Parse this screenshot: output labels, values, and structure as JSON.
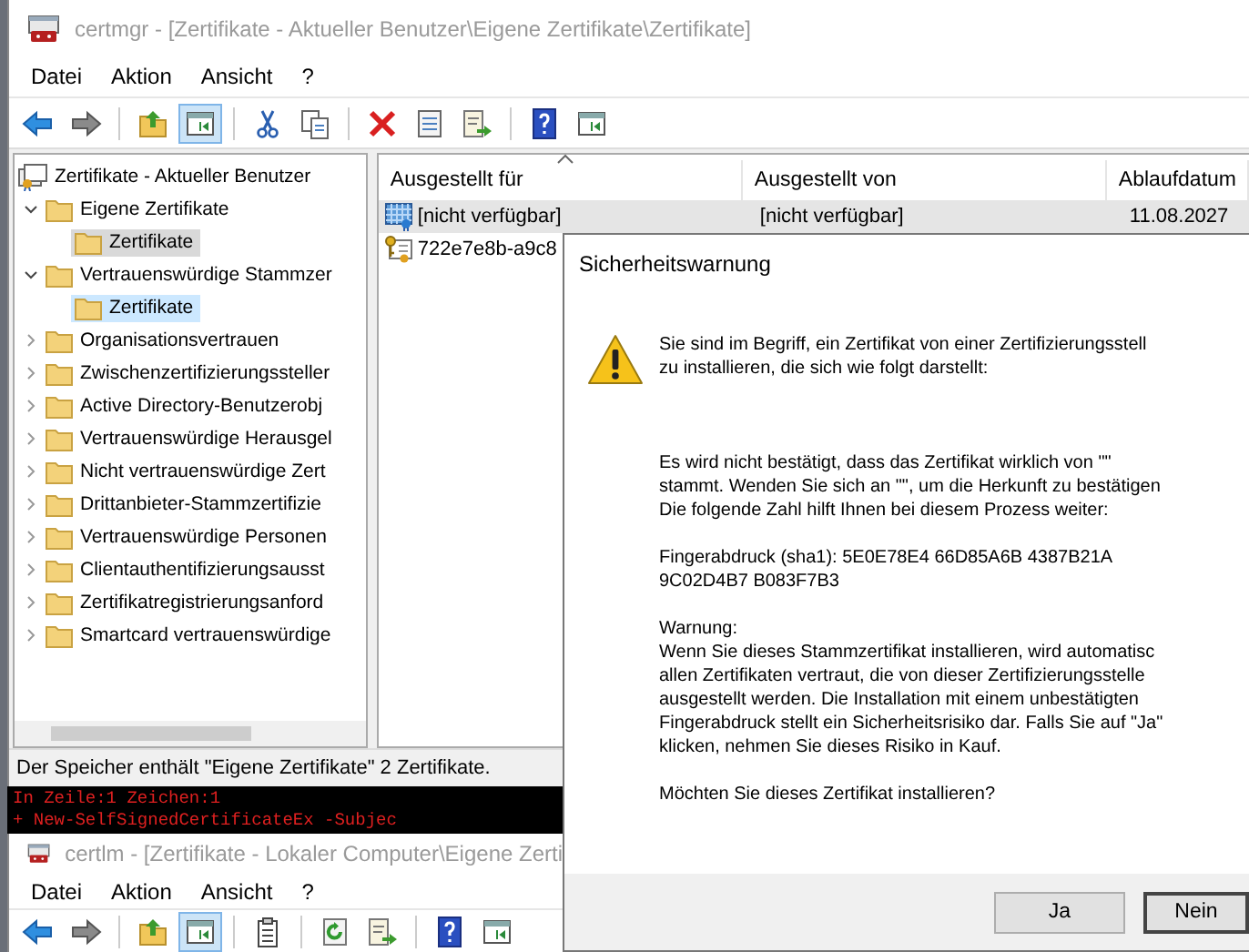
{
  "main_window": {
    "title": "certmgr - [Zertifikate - Aktueller Benutzer\\Eigene Zertifikate\\Zertifikate]",
    "menu": [
      "Datei",
      "Aktion",
      "Ansicht",
      "?"
    ],
    "toolbar": [
      {
        "buttons": [
          {
            "kind": "back",
            "pressed": false
          },
          {
            "kind": "forward",
            "pressed": false
          }
        ]
      },
      {
        "buttons": [
          {
            "kind": "folder-up",
            "pressed": false
          },
          {
            "kind": "pane",
            "pressed": true
          }
        ]
      },
      {
        "buttons": [
          {
            "kind": "cut",
            "pressed": false
          },
          {
            "kind": "copy",
            "pressed": false
          }
        ]
      },
      {
        "buttons": [
          {
            "kind": "delete",
            "pressed": false
          },
          {
            "kind": "properties",
            "pressed": false
          },
          {
            "kind": "export",
            "pressed": false
          }
        ]
      },
      {
        "buttons": [
          {
            "kind": "help",
            "pressed": false
          },
          {
            "kind": "panel",
            "pressed": false
          }
        ]
      }
    ],
    "tree": {
      "root": "Zertifikate - Aktueller Benutzer",
      "items": [
        {
          "label": "Eigene Zertifikate",
          "expanded": true,
          "children": [
            {
              "label": "Zertifikate",
              "selected": true,
              "hovered": false
            }
          ]
        },
        {
          "label": "Vertrauenswürdige Stammzer",
          "expanded": true,
          "children": [
            {
              "label": "Zertifikate",
              "selected": false,
              "hovered": true
            }
          ]
        },
        {
          "label": "Organisationsvertrauen",
          "expanded": false
        },
        {
          "label": "Zwischenzertifizierungssteller",
          "expanded": false
        },
        {
          "label": "Active Directory-Benutzerobj",
          "expanded": false
        },
        {
          "label": "Vertrauenswürdige Herausgel",
          "expanded": false
        },
        {
          "label": "Nicht vertrauenswürdige Zert",
          "expanded": false
        },
        {
          "label": "Drittanbieter-Stammzertifizie",
          "expanded": false
        },
        {
          "label": "Vertrauenswürdige Personen",
          "expanded": false
        },
        {
          "label": "Clientauthentifizierungsausst",
          "expanded": false
        },
        {
          "label": "Zertifikatregistrierungsanford",
          "expanded": false
        },
        {
          "label": "Smartcard vertrauenswürdige",
          "expanded": false
        }
      ]
    },
    "list": {
      "columns": [
        "Ausgestellt für",
        "Ausgestellt von",
        "Ablaufdatum"
      ],
      "rows": [
        {
          "kind": "checkered",
          "selected": true,
          "cells": [
            "[nicht verfügbar]",
            "[nicht verfügbar]",
            "11.08.2027"
          ]
        },
        {
          "kind": "key",
          "selected": false,
          "cells": [
            "722e7e8b-a9c8"
          ]
        }
      ]
    },
    "status_bar": "Der Speicher enthält \"Eigene Zertifikate\" 2 Zertifikate."
  },
  "console": {
    "lines": [
      "In Zeile:1 Zeichen:1",
      "+ New-SelfSignedCertificateEx -Subjec"
    ]
  },
  "second_window": {
    "title": "certlm - [Zertifikate - Lokaler Computer\\Eigene Zerti",
    "menu": [
      "Datei",
      "Aktion",
      "Ansicht",
      "?"
    ],
    "toolbar": [
      {
        "buttons": [
          {
            "kind": "back",
            "pressed": false
          },
          {
            "kind": "forward",
            "pressed": false
          }
        ]
      },
      {
        "buttons": [
          {
            "kind": "folder-up",
            "pressed": false
          },
          {
            "kind": "pane",
            "pressed": true
          }
        ]
      },
      {
        "buttons": [
          {
            "kind": "clipboard",
            "pressed": false
          }
        ]
      },
      {
        "buttons": [
          {
            "kind": "refresh",
            "pressed": false
          },
          {
            "kind": "export",
            "pressed": false
          }
        ]
      },
      {
        "buttons": [
          {
            "kind": "help",
            "pressed": false
          },
          {
            "kind": "panel",
            "pressed": false
          }
        ]
      }
    ]
  },
  "dialog": {
    "title": "Sicherheitswarnung",
    "paragraphs": [
      {
        "lines": [
          "Sie sind im Begriff, ein Zertifikat von einer Zertifizierungsstell",
          "zu installieren, die sich wie folgt darstellt:"
        ]
      },
      {
        "lines": [
          "Es wird nicht bestätigt, dass das Zertifikat wirklich von \"\"",
          "stammt. Wenden Sie sich an \"\", um die Herkunft zu bestätigen",
          "Die folgende Zahl hilft Ihnen bei diesem Prozess weiter:"
        ]
      },
      {
        "lines": [
          "Fingerabdruck (sha1): 5E0E78E4 66D85A6B 4387B21A",
          "9C02D4B7 B083F7B3"
        ]
      },
      {
        "lines": [
          "Warnung:",
          "Wenn Sie dieses Stammzertifikat installieren, wird automatisc",
          "allen Zertifikaten vertraut, die von dieser Zertifizierungsstelle",
          "ausgestellt werden. Die Installation mit einem unbestätigten",
          "Fingerabdruck stellt ein Sicherheitsrisiko dar. Falls Sie auf \"Ja\"",
          "klicken, nehmen Sie dieses Risiko in Kauf."
        ]
      },
      {
        "lines": [
          "Möchten Sie dieses Zertifikat installieren?"
        ]
      }
    ],
    "buttons": [
      {
        "label": "Ja",
        "default": false
      },
      {
        "label": "Nein",
        "default": true
      }
    ]
  }
}
